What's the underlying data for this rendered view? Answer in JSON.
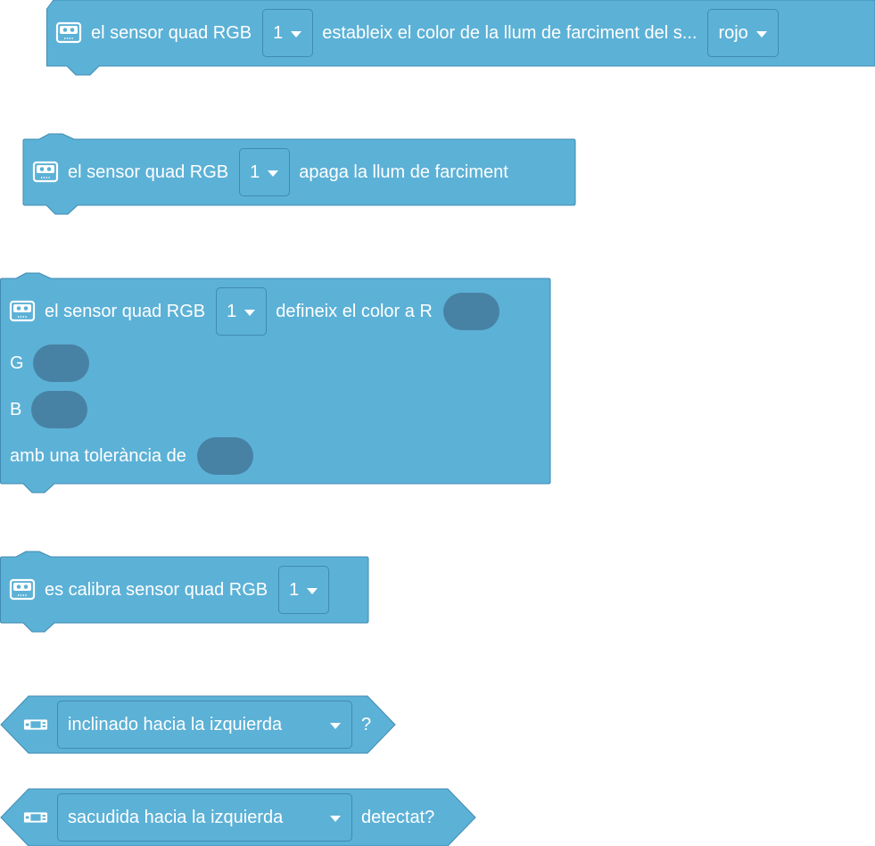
{
  "colors": {
    "block_fill": "#5cb1d6",
    "block_stroke": "#3f8bb3",
    "input_slot": "#4782a4",
    "text": "#ffffff"
  },
  "blocks": [
    {
      "icon": "quad-rgb-sensor-icon",
      "label_a": "el sensor quad RGB",
      "dropdown": "1",
      "label_b": "estableix el color de la llum de farciment del s...",
      "color_dropdown": "rojo"
    },
    {
      "icon": "quad-rgb-sensor-icon",
      "label_a": "el sensor quad RGB",
      "dropdown": "1",
      "label_b": "apaga la llum de farciment"
    },
    {
      "icon": "quad-rgb-sensor-icon",
      "label_a": "el sensor quad RGB",
      "dropdown": "1",
      "label_b": "defineix el color a R",
      "label_g": "G",
      "label_bb": "B",
      "label_tol": "amb una tolerància de"
    },
    {
      "icon": "quad-rgb-sensor-icon",
      "label_a": "es calibra sensor quad RGB",
      "dropdown": "1"
    },
    {
      "icon": "gamepad-icon",
      "dropdown": "inclinado hacia la izquierda",
      "suffix": "?"
    },
    {
      "icon": "gamepad-icon",
      "dropdown": "sacudida hacia la izquierda",
      "suffix": "detectat?"
    }
  ]
}
